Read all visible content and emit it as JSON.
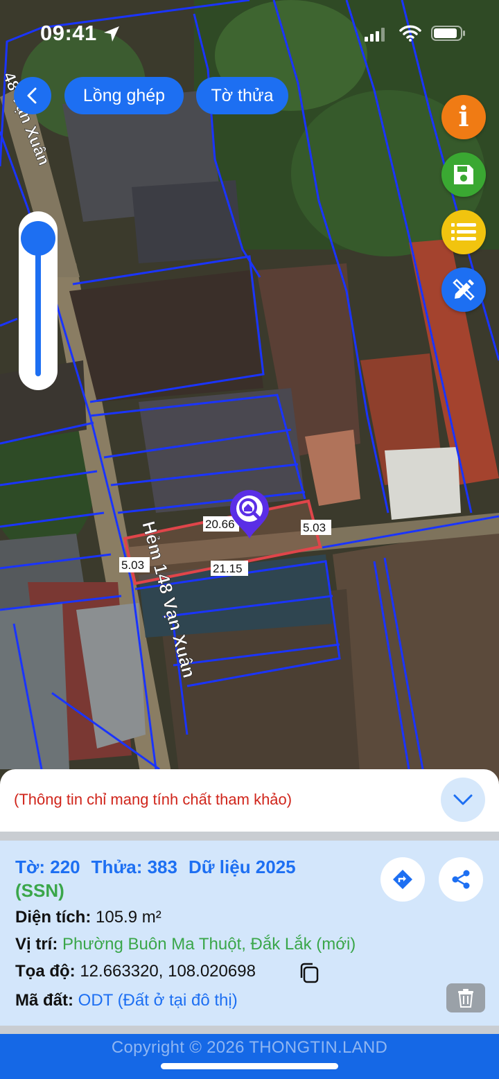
{
  "status_bar": {
    "time": "09:41"
  },
  "nav": {
    "back_icon": "chevron-left-icon",
    "overlay_label": "Lồng ghép",
    "sheet_label": "Tờ thửa"
  },
  "actions": {
    "info_icon": "info-icon",
    "info_glyph": "i",
    "save_icon": "floppy-icon",
    "list_icon": "list-icon",
    "edit_icon": "pen-ruler-icon"
  },
  "map": {
    "street_name": "Hẻm 148 Vạn Xuân",
    "street_name_top": "48 Vạn Xuân",
    "parcel": {
      "edge_top": "20.66",
      "edge_right": "5.03",
      "edge_left": "5.03",
      "edge_bottom": "21.15"
    },
    "colors": {
      "boundary": "#1a34ff",
      "parcel_outline": "#e0454a"
    }
  },
  "notice": {
    "text": "(Thông tin chỉ mang tính chất tham khảo)"
  },
  "parcel_info": {
    "sheet_label": "Tờ: 220",
    "parcel_label": "Thửa: 383",
    "data_label": "Dữ liệu 2025",
    "source": "(SSN)",
    "area_label": "Diện tích:",
    "area_value": "105.9 m²",
    "location_label": "Vị trí:",
    "location_value": "Phường Buôn Ma Thuột, Đắk Lắk (mới)",
    "coord_label": "Tọa độ:",
    "coord_value": "12.663320, 108.020698",
    "landcode_label": "Mã đất:",
    "landcode_value": "ODT (Đất ở tại đô thị)"
  },
  "footer": {
    "copyright": "Copyright © 2026 THONGTIN.LAND"
  },
  "theme": {
    "primary": "#1d6ff2",
    "green": "#3aa64a",
    "warning": "#d0251b",
    "orange": "#f07b14",
    "yellow": "#f1c40f"
  }
}
